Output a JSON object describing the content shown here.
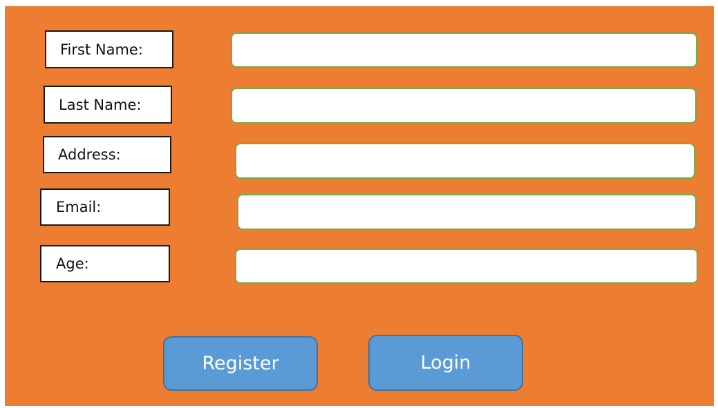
{
  "form": {
    "fields": [
      {
        "label": "First Name:",
        "value": "",
        "placeholder": ""
      },
      {
        "label": "Last Name:",
        "value": "",
        "placeholder": ""
      },
      {
        "label": "Address:",
        "value": "",
        "placeholder": ""
      },
      {
        "label": "Email:",
        "value": "",
        "placeholder": ""
      },
      {
        "label": "Age:",
        "value": "",
        "placeholder": ""
      }
    ]
  },
  "buttons": {
    "register_label": "Register",
    "login_label": "Login"
  },
  "colors": {
    "background": "#ED7D31",
    "button_fill": "#5B9BD5",
    "button_border": "#41719C",
    "field_border": "#70AD47",
    "label_border": "#1a1a1a"
  }
}
